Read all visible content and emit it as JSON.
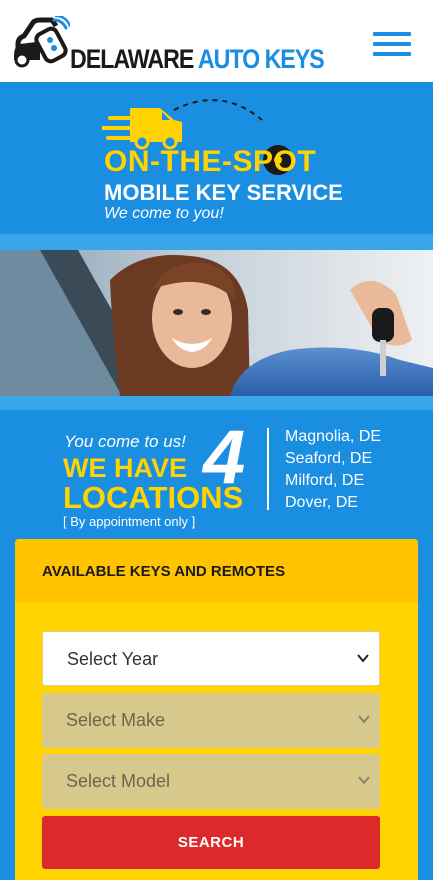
{
  "header": {
    "logo_word1": "DELAWARE",
    "logo_word2": "AUTO KEYS",
    "menu_icon": "hamburger-menu-icon"
  },
  "banner": {
    "line1": "ON-THE-SPOT",
    "line2": "MOBILE KEY SERVICE",
    "line3": "We come to you!",
    "icon": "delivery-van-icon"
  },
  "photo": {
    "subject": "woman-in-car-holding-key-image"
  },
  "locations": {
    "intro": "You come to us!",
    "we_have": "WE HAVE",
    "count": "4",
    "label": "LOCATIONS",
    "note": "[ By appointment only ]",
    "cities": [
      "Magnolia, DE",
      "Seaford, DE",
      "Milford, DE",
      "Dover, DE"
    ]
  },
  "keys_form": {
    "title": "AVAILABLE KEYS AND REMOTES",
    "year_select": "Select Year",
    "make_select": "Select Make",
    "model_select": "Select Model",
    "search_button": "SEARCH"
  },
  "colors": {
    "brand_blue": "#1a8ee0",
    "accent_yellow": "#ffd200",
    "button_red": "#dc2a2a"
  }
}
